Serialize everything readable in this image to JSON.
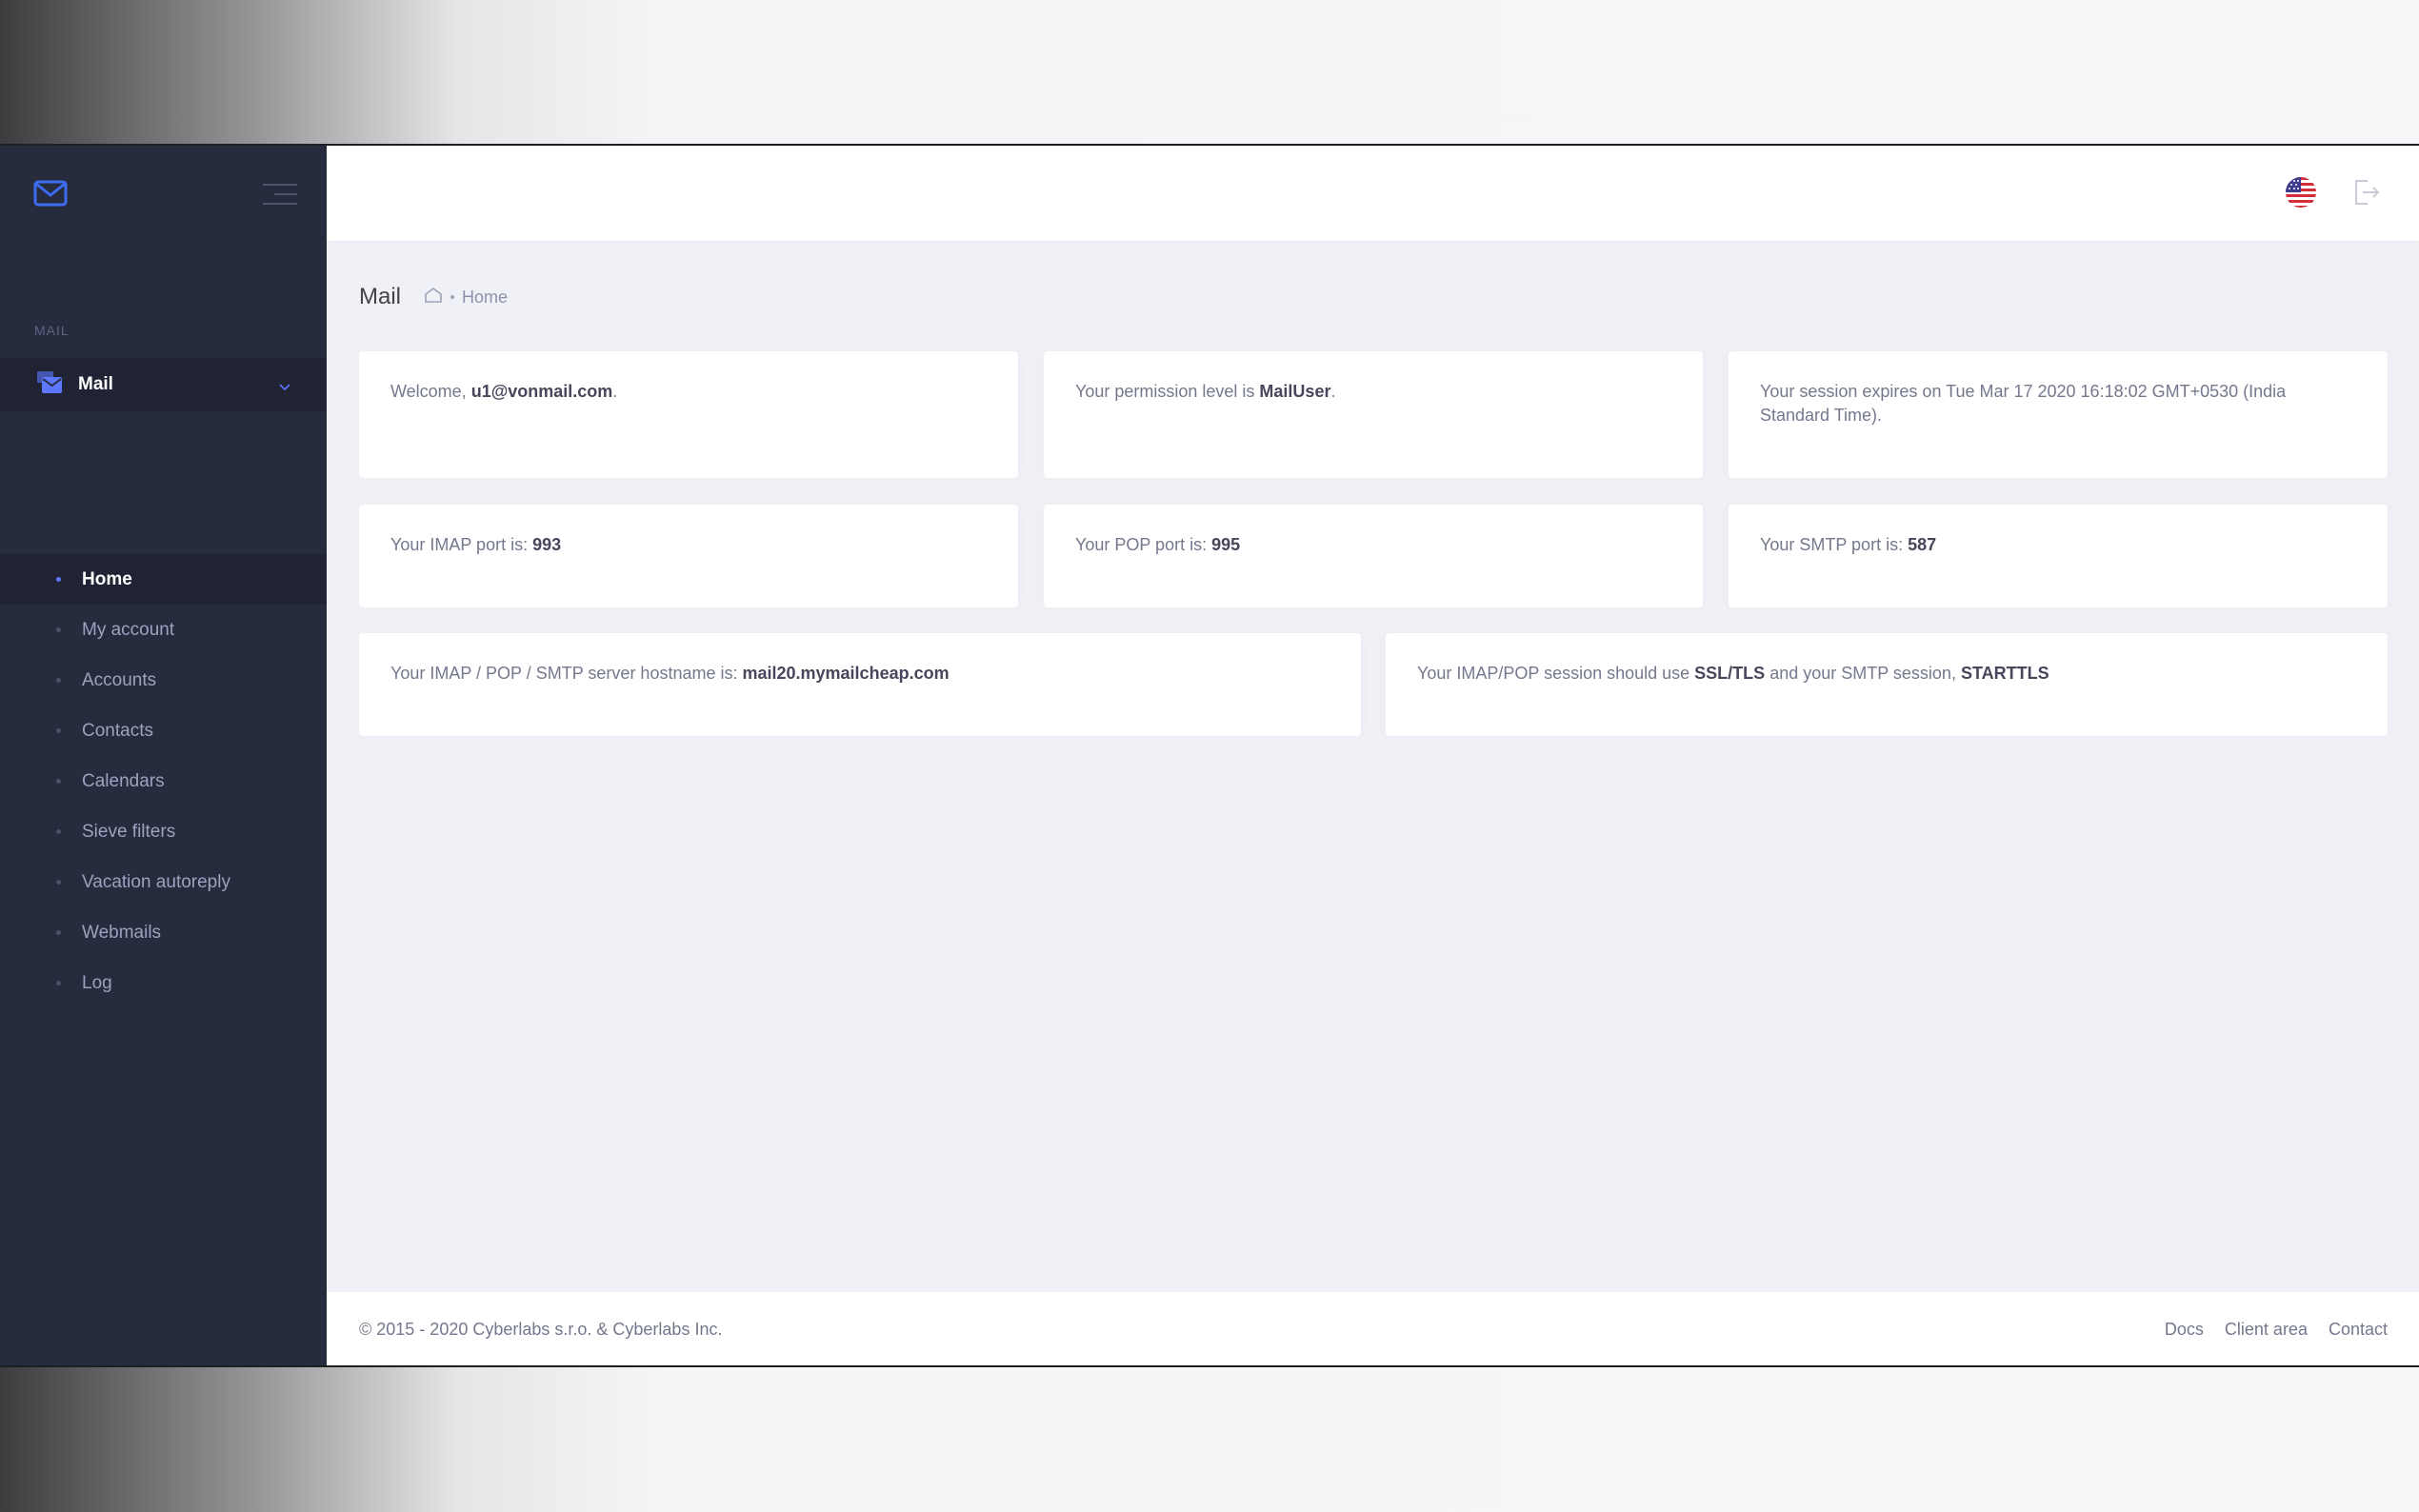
{
  "sidebar": {
    "section_label": "MAIL",
    "parent": {
      "label": "Mail"
    },
    "items": [
      {
        "label": "Home",
        "active": true
      },
      {
        "label": "My account"
      },
      {
        "label": "Accounts"
      },
      {
        "label": "Contacts"
      },
      {
        "label": "Calendars"
      },
      {
        "label": "Sieve filters"
      },
      {
        "label": "Vacation autoreply"
      },
      {
        "label": "Webmails"
      },
      {
        "label": "Log"
      }
    ]
  },
  "subheader": {
    "title": "Mail",
    "breadcrumb": "Home"
  },
  "cards": {
    "welcome": {
      "prefix": "Welcome, ",
      "value": "u1@vonmail.com",
      "suffix": "."
    },
    "permission": {
      "prefix": "Your permission level is ",
      "value": "MailUser",
      "suffix": "."
    },
    "session": {
      "text": "Your session expires on Tue Mar 17 2020 16:18:02 GMT+0530 (India Standard Time)."
    },
    "imap": {
      "prefix": "Your IMAP port is: ",
      "value": "993"
    },
    "pop": {
      "prefix": "Your POP port is: ",
      "value": "995"
    },
    "smtp": {
      "prefix": "Your SMTP port is: ",
      "value": "587"
    },
    "hostname": {
      "prefix": "Your IMAP / POP / SMTP server hostname is: ",
      "value": "mail20.mymailcheap.com"
    },
    "security": {
      "prefix": "Your IMAP/POP session should use ",
      "value1": "SSL/TLS",
      "middle": " and your SMTP session, ",
      "value2": "STARTTLS"
    }
  },
  "footer": {
    "copyright": "© 2015 - 2020 Cyberlabs s.r.o. & Cyberlabs Inc.",
    "links": [
      "Docs",
      "Client area",
      "Contact"
    ]
  },
  "colors": {
    "sidebar_bg": "#262b3d",
    "accent": "#5d78ff",
    "content_bg": "#f0f1f6"
  },
  "icons": {
    "brand": "envelope-icon",
    "menu_toggle": "hamburger-icon",
    "mail_section": "mail-stack-icon",
    "breadcrumb_home": "home-icon",
    "language": "us-flag-icon",
    "logout": "logout-icon"
  }
}
